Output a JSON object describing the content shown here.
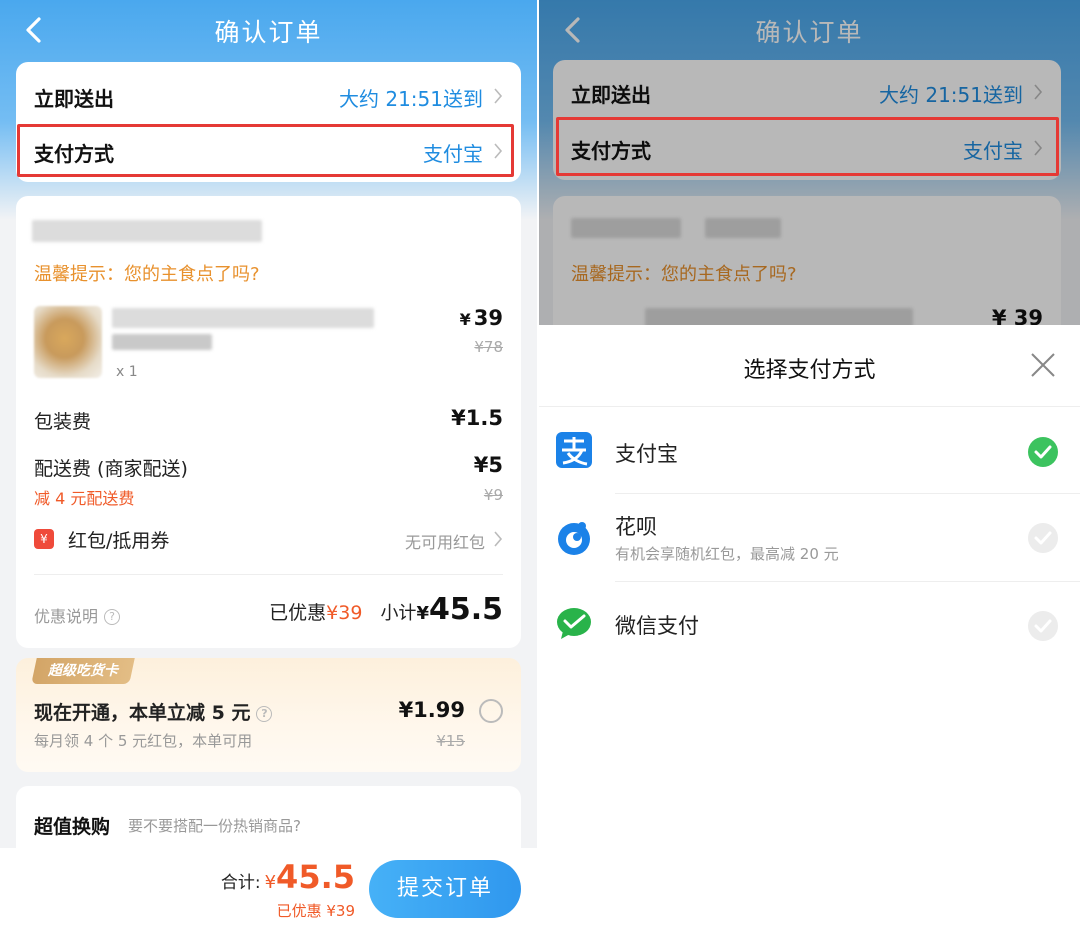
{
  "left": {
    "header": {
      "title": "确认订单"
    },
    "delivery": {
      "label": "立即送出",
      "value": "大约 21:51送到"
    },
    "payment": {
      "label": "支付方式",
      "value": "支付宝"
    },
    "order": {
      "tip": "温馨提示：您的主食点了吗?",
      "item": {
        "qty": "x 1",
        "price_symbol": "¥",
        "price": "39",
        "original_price": "¥78"
      },
      "packing": {
        "label": "包装费",
        "value": "¥1.5"
      },
      "shipping": {
        "label": "配送费 (商家配送)",
        "value": "¥5",
        "discount": "减 4 元配送费",
        "original": "¥9"
      },
      "coupon": {
        "icon_text": "¥",
        "label": "红包/抵用券",
        "value": "无可用红包"
      },
      "summary": {
        "note": "优惠说明",
        "saved_label": "已优惠",
        "saved_value": "¥39",
        "subtotal_label": "小计",
        "subtotal_symbol": "¥",
        "subtotal_value": "45.5"
      }
    },
    "vip": {
      "badge": "超级吃货卡",
      "title": "现在开通，本单立减 5 元",
      "subtitle": "每月领 4 个 5 元红包，本单可用",
      "price": "¥1.99",
      "original_price": "¥15"
    },
    "upsell": {
      "title": "超值换购",
      "subtitle": "要不要搭配一份热销商品?"
    },
    "bottom": {
      "total_label": "合计:",
      "total_symbol": "¥",
      "total_value": "45.5",
      "saved": "已优惠 ¥39",
      "submit": "提交订单"
    }
  },
  "right": {
    "header": {
      "title": "确认订单"
    },
    "delivery": {
      "label": "立即送出",
      "value": "大约 21:51送到"
    },
    "payment": {
      "label": "支付方式",
      "value": "支付宝"
    },
    "tip": "温馨提示：您的主食点了吗?",
    "peek_price": "¥ 39",
    "sheet": {
      "title": "选择支付方式",
      "options": [
        {
          "name": "支付宝",
          "desc": "",
          "selected": true,
          "icon": "alipay-icon"
        },
        {
          "name": "花呗",
          "desc": "有机会享随机红包，最高减 20 元",
          "selected": false,
          "icon": "huabei-icon"
        },
        {
          "name": "微信支付",
          "desc": "",
          "selected": false,
          "icon": "wechat-pay-icon"
        }
      ]
    }
  },
  "colors": {
    "brand_blue": "#1f8ce0",
    "highlight_red": "#e53935",
    "tip_orange": "#e8912d",
    "discount_red": "#f05a28",
    "check_green": "#3cc35f"
  }
}
